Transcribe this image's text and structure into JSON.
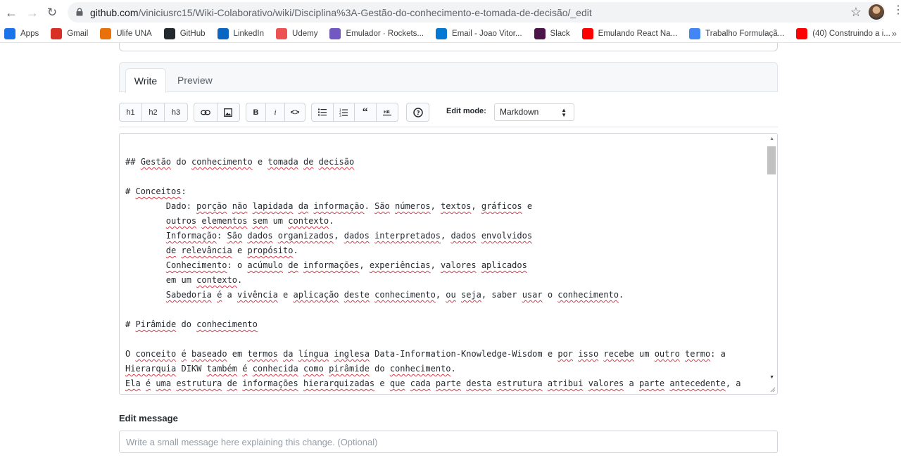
{
  "browser": {
    "url_host": "github.com",
    "url_path": "/viniciusrc15/Wiki-Colaborativo/wiki/Disciplina%3A-Gestão-do-conhecimento-e-tomada-de-decisão/_edit",
    "bookmarks": [
      {
        "label": "Apps",
        "icon": "apps-grid-icon",
        "color": "#1a73e8"
      },
      {
        "label": "Gmail",
        "icon": "gmail-icon",
        "color": "#d93025"
      },
      {
        "label": "Ulife UNA",
        "icon": "ulife-icon",
        "color": "#e8710a"
      },
      {
        "label": "GitHub",
        "icon": "github-icon",
        "color": "#24292e"
      },
      {
        "label": "LinkedIn",
        "icon": "linkedin-icon",
        "color": "#0a66c2"
      },
      {
        "label": "Udemy",
        "icon": "udemy-icon",
        "color": "#ec5252"
      },
      {
        "label": "Emulador · Rockets...",
        "icon": "rocketseat-icon",
        "color": "#7159c1"
      },
      {
        "label": "Email - Joao Vitor...",
        "icon": "mail-icon",
        "color": "#0078d4"
      },
      {
        "label": "Slack",
        "icon": "slack-icon",
        "color": "#4a154b"
      },
      {
        "label": "Emulando React Na...",
        "icon": "youtube-icon",
        "color": "#ff0000"
      },
      {
        "label": "Trabalho Formulaçã...",
        "icon": "google-docs-icon",
        "color": "#4285f4"
      },
      {
        "label": "(40) Construindo a i...",
        "icon": "youtube-icon",
        "color": "#ff0000"
      }
    ]
  },
  "editor": {
    "tabs": {
      "write": "Write",
      "preview": "Preview"
    },
    "toolbar": {
      "headings": [
        "h1",
        "h2",
        "h3"
      ],
      "edit_mode_label": "Edit mode:",
      "edit_mode_value": "Markdown"
    },
    "lines": [
      "## Gestão do conhecimento e tomada de decisão",
      "",
      "# Conceitos:",
      "        Dado: porção não lapidada da informação. São números, textos, gráficos e",
      "        outros elementos sem um contexto.",
      "        Informação: São dados organizados, dados interpretados, dados envolvidos",
      "        de relevância e propósito.",
      "        Conhecimento: o acúmulo de informações, experiências, valores aplicados",
      "        em um contexto.",
      "        Sabedoria é a vivência e aplicação deste conhecimento, ou seja, saber usar o conhecimento.",
      "",
      "# Pirâmide do conhecimento",
      "",
      "O conceito é baseado em termos da língua inglesa Data-Information-Knowledge-Wisdom e por isso recebe um outro termo: a",
      "Hierarquia DIKW também é conhecida como pirâmide do conhecimento.",
      "Ela é uma estrutura de informações hierarquizadas e que cada parte desta estrutura atribui valores a parte antecedente, a"
    ],
    "misspelled": [
      "Gestão",
      "conhecimento",
      "tomada",
      "decisão",
      "Conceitos",
      "porção",
      "não",
      "lapidada",
      "da",
      "informação",
      "São",
      "números",
      "textos",
      "gráficos",
      "outros",
      "elementos",
      "sem",
      "contexto",
      "Informação",
      "dados",
      "organizados",
      "interpretados",
      "envolvidos",
      "de",
      "relevância",
      "propósito",
      "Conhecimento",
      "acúmulo",
      "informações",
      "experiências",
      "valores",
      "aplicados",
      "Sabedoria",
      "é",
      "vivência",
      "aplicação",
      "deste",
      "ou",
      "seja",
      "usar",
      "Pirâmide",
      "conceito",
      "baseado",
      "termos",
      "língua",
      "inglesa",
      "por",
      "isso",
      "recebe",
      "outro",
      "termo",
      "Hierarquia",
      "também",
      "conhecida",
      "como",
      "pirâmide",
      "Ela",
      "uma",
      "estrutura",
      "hierarquizadas",
      "que",
      "cada",
      "parte",
      "desta",
      "atribui",
      "antecedente"
    ]
  },
  "edit_message": {
    "label": "Edit message",
    "placeholder": "Write a small message here explaining this change. (Optional)"
  }
}
